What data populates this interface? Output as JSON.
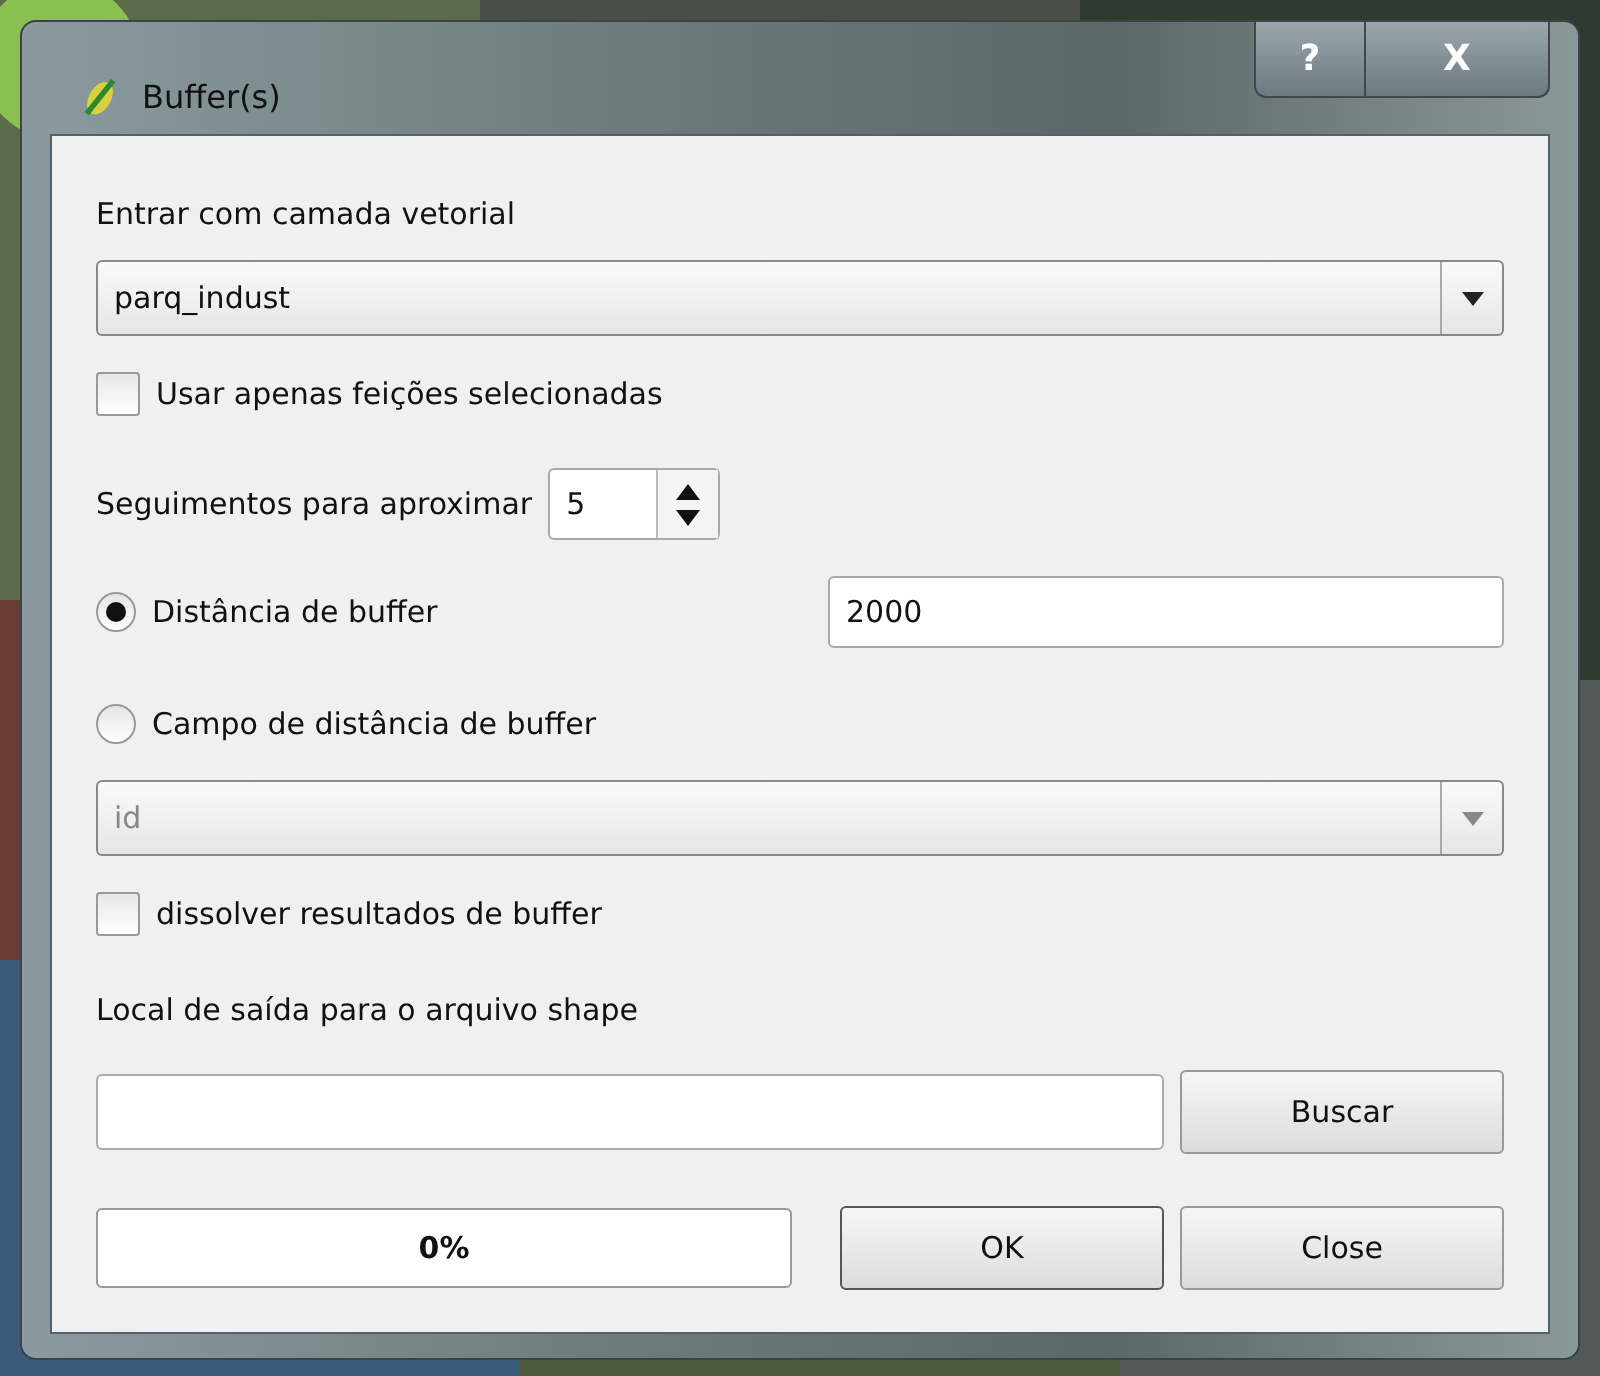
{
  "window": {
    "title": "Buffer(s)",
    "controls": [
      {
        "kind": "help",
        "label": "?"
      },
      {
        "kind": "close",
        "label": "X"
      }
    ]
  },
  "input_layer": {
    "label": "Entrar com camada vetorial",
    "value": "parq_indust",
    "disabled": false
  },
  "use_selected": {
    "label": "Usar apenas feições selecionadas",
    "checked": false
  },
  "segments": {
    "label": "Seguimentos para aproximar",
    "value": "5"
  },
  "distance_options": [
    {
      "label": "Distância de buffer",
      "selected": true,
      "value": "2000"
    },
    {
      "label": "Campo de distância de buffer",
      "selected": false
    }
  ],
  "field_combo": {
    "value": "id",
    "disabled": true
  },
  "dissolve": {
    "label": "dissolver resultados de buffer",
    "checked": false
  },
  "output": {
    "label": "Local de saída para o arquivo shape",
    "browse_button": "Buscar"
  },
  "progress": {
    "level": 0,
    "text": "0%"
  },
  "buttons": [
    "OK",
    "Close"
  ]
}
